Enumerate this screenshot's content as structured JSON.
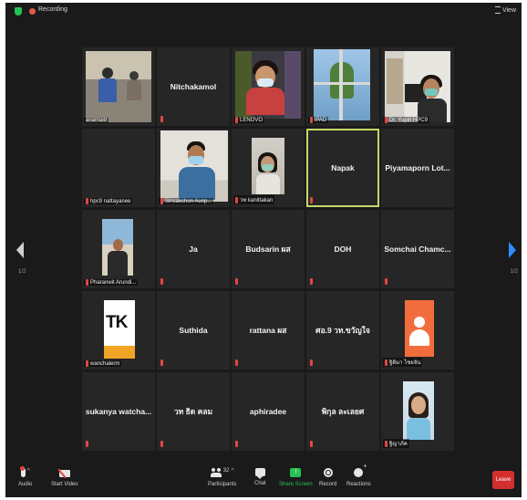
{
  "topbar": {
    "recording_label": "Recording",
    "view_label": "View"
  },
  "nav": {
    "page_left": "1/2",
    "page_right": "1/2"
  },
  "tiles": [
    {
      "label": "anamai9"
    },
    {
      "name": "Nitchakamol"
    },
    {
      "label": "LENOVO"
    },
    {
      "label": "iPAD"
    },
    {
      "label": "Dr. Yupin HPC9"
    },
    {
      "label": "hpc9 nattayanee"
    },
    {
      "label": "Sinsakchon Aunp..."
    },
    {
      "label": "วท kanittakan"
    },
    {
      "name": "Napak"
    },
    {
      "name": "Piyamaporn Lot..."
    },
    {
      "label": "Pharanwit Arundi..."
    },
    {
      "name": "Ja"
    },
    {
      "name": "Budsarin ผส"
    },
    {
      "name": "DOH"
    },
    {
      "name": "Somchai Chamc..."
    },
    {
      "label": "wanchalerm",
      "logo": "TK"
    },
    {
      "name": "Suthida"
    },
    {
      "name": "rattana ผส"
    },
    {
      "name": "ศอ.9 วท.ขวัญใจ"
    },
    {
      "label": "ฐิติมา ไชยจัน"
    },
    {
      "name": "sukanya watcha..."
    },
    {
      "name": "วท ธิด คลม"
    },
    {
      "name": "aphiradee"
    },
    {
      "name": "พิกุล ละเลยศ"
    },
    {
      "label": "ฐิญาภัค"
    }
  ],
  "toolbar": {
    "audio": "Audio",
    "start_video": "Start Video",
    "participants": "Participants",
    "participant_count": "32",
    "chat": "Chat",
    "share_screen": "Share Screen",
    "record": "Record",
    "reactions": "Reactions",
    "leave": "Leave"
  },
  "colors": {
    "background": "#1a1a1a",
    "tile": "#262626",
    "active_speaker": "#c7d867",
    "share_green": "#27c252",
    "leave_red": "#d42f2f",
    "next_arrow": "#2d8cff"
  }
}
